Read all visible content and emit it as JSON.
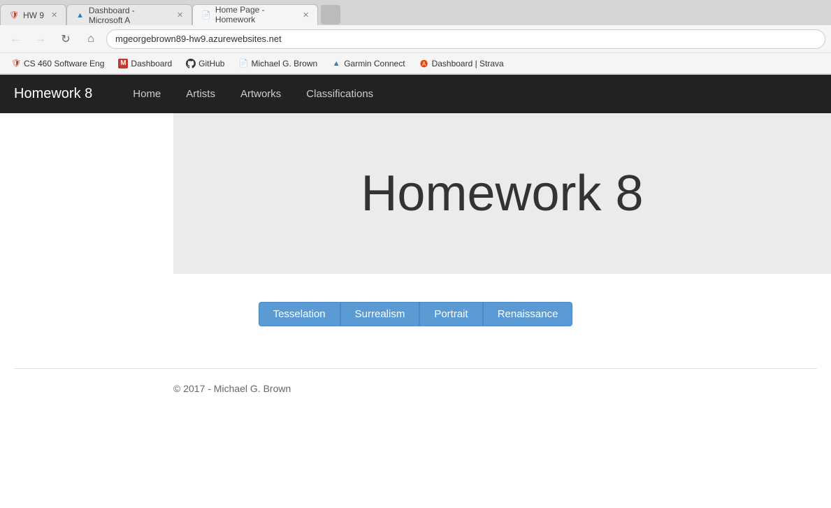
{
  "browser": {
    "tabs": [
      {
        "id": "tab1",
        "label": "HW 9",
        "icon": "shield",
        "active": false,
        "closable": true
      },
      {
        "id": "tab2",
        "label": "Dashboard - Microsoft A",
        "icon": "triangle",
        "active": false,
        "closable": true
      },
      {
        "id": "tab3",
        "label": "Home Page - Homework",
        "icon": "page",
        "active": true,
        "closable": true
      }
    ],
    "address": "mgeorgebrown89-hw9.azurewebsites.net",
    "bookmarks": [
      {
        "id": "bm1",
        "label": "CS 460 Software Eng",
        "icon": "shield-red"
      },
      {
        "id": "bm2",
        "label": "Dashboard",
        "icon": "m-red"
      },
      {
        "id": "bm3",
        "label": "GitHub",
        "icon": "github"
      },
      {
        "id": "bm4",
        "label": "Michael G. Brown",
        "icon": "doc"
      },
      {
        "id": "bm5",
        "label": "Garmin Connect",
        "icon": "garmin"
      },
      {
        "id": "bm6",
        "label": "Dashboard | Strava",
        "icon": "strava"
      }
    ]
  },
  "app": {
    "brand": "Homework 8",
    "nav": {
      "links": [
        {
          "id": "home",
          "label": "Home"
        },
        {
          "id": "artists",
          "label": "Artists"
        },
        {
          "id": "artworks",
          "label": "Artworks"
        },
        {
          "id": "classifications",
          "label": "Classifications"
        }
      ]
    },
    "hero": {
      "title": "Homework 8"
    },
    "classifications": {
      "buttons": [
        {
          "id": "tesselation",
          "label": "Tesselation"
        },
        {
          "id": "surrealism",
          "label": "Surrealism"
        },
        {
          "id": "portrait",
          "label": "Portrait"
        },
        {
          "id": "renaissance",
          "label": "Renaissance"
        }
      ]
    },
    "footer": {
      "copyright": "© 2017 - Michael G. Brown"
    }
  }
}
